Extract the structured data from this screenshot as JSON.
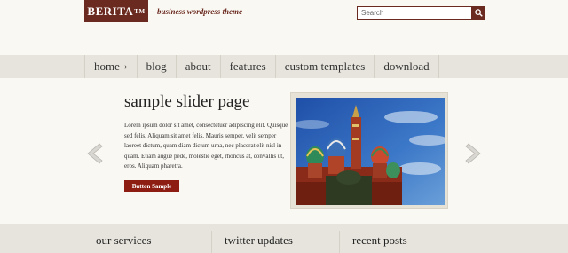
{
  "header": {
    "logo_text": "BERITA",
    "logo_tm": "TM",
    "tagline": "business wordpress theme",
    "search_placeholder": "Search",
    "search_icon": "magnifier-icon"
  },
  "nav": {
    "items": [
      {
        "label": "home",
        "has_submenu": true
      },
      {
        "label": "blog"
      },
      {
        "label": "about"
      },
      {
        "label": "features"
      },
      {
        "label": "custom templates"
      },
      {
        "label": "download"
      }
    ],
    "submenu_arrow": "›"
  },
  "slider": {
    "title": "sample slider page",
    "text": "Lorem ipsum dolor sit amet, consectetuer adipiscing elit. Quisque sed felis. Aliquam sit amet felis. Mauris semper, velit semper laoreet dictum, quam diam dictum urna, nec placerat elit nisl in quam. Etiam augue pede, molestie eget, rhoncus at, convallis ut, eros. Aliquam pharetra.",
    "button_label": "Button Sample",
    "image_alt": "St. Basil's Cathedral",
    "prev_icon": "chevron-left-icon",
    "next_icon": "chevron-right-icon"
  },
  "footer": {
    "columns": [
      {
        "title": "our services"
      },
      {
        "title": "twitter updates"
      },
      {
        "title": "recent posts"
      }
    ]
  },
  "colors": {
    "brand": "#6b2a1f",
    "button": "#8d1c12",
    "background": "#faf8f3",
    "band": "#e6e4dc"
  }
}
